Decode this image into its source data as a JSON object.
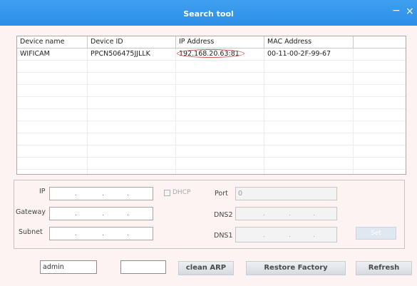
{
  "window": {
    "title": "Search tool",
    "minimize_glyph": "−",
    "close_glyph": "×"
  },
  "table": {
    "headers": [
      "Device name",
      "Device ID",
      "IP Address",
      "MAC Address",
      ""
    ],
    "rows": [
      {
        "device_name": "WIFICAM",
        "device_id": "PPCN506475JJLLK",
        "ip_address": "192.168.20.63:81",
        "mac_address": "00-11-00-2F-99-67"
      }
    ],
    "highlight_color": "#d9534f"
  },
  "network": {
    "ip_label": "IP",
    "gateway_label": "Gateway",
    "subnet_label": "Subnet",
    "dhcp_label": "DHCP",
    "port_label": "Port",
    "port_value": "0",
    "dns2_label": "DNS2",
    "dns1_label": "DNS1",
    "dot": ".",
    "set_button": "Set"
  },
  "footer": {
    "username_value": "admin",
    "password_value": "",
    "clean_arp_button": "clean ARP",
    "restore_factory_button": "Restore Factory",
    "refresh_button": "Refresh"
  },
  "colors": {
    "titlebar": "#2c8fe8",
    "background": "#fdf3f3"
  }
}
